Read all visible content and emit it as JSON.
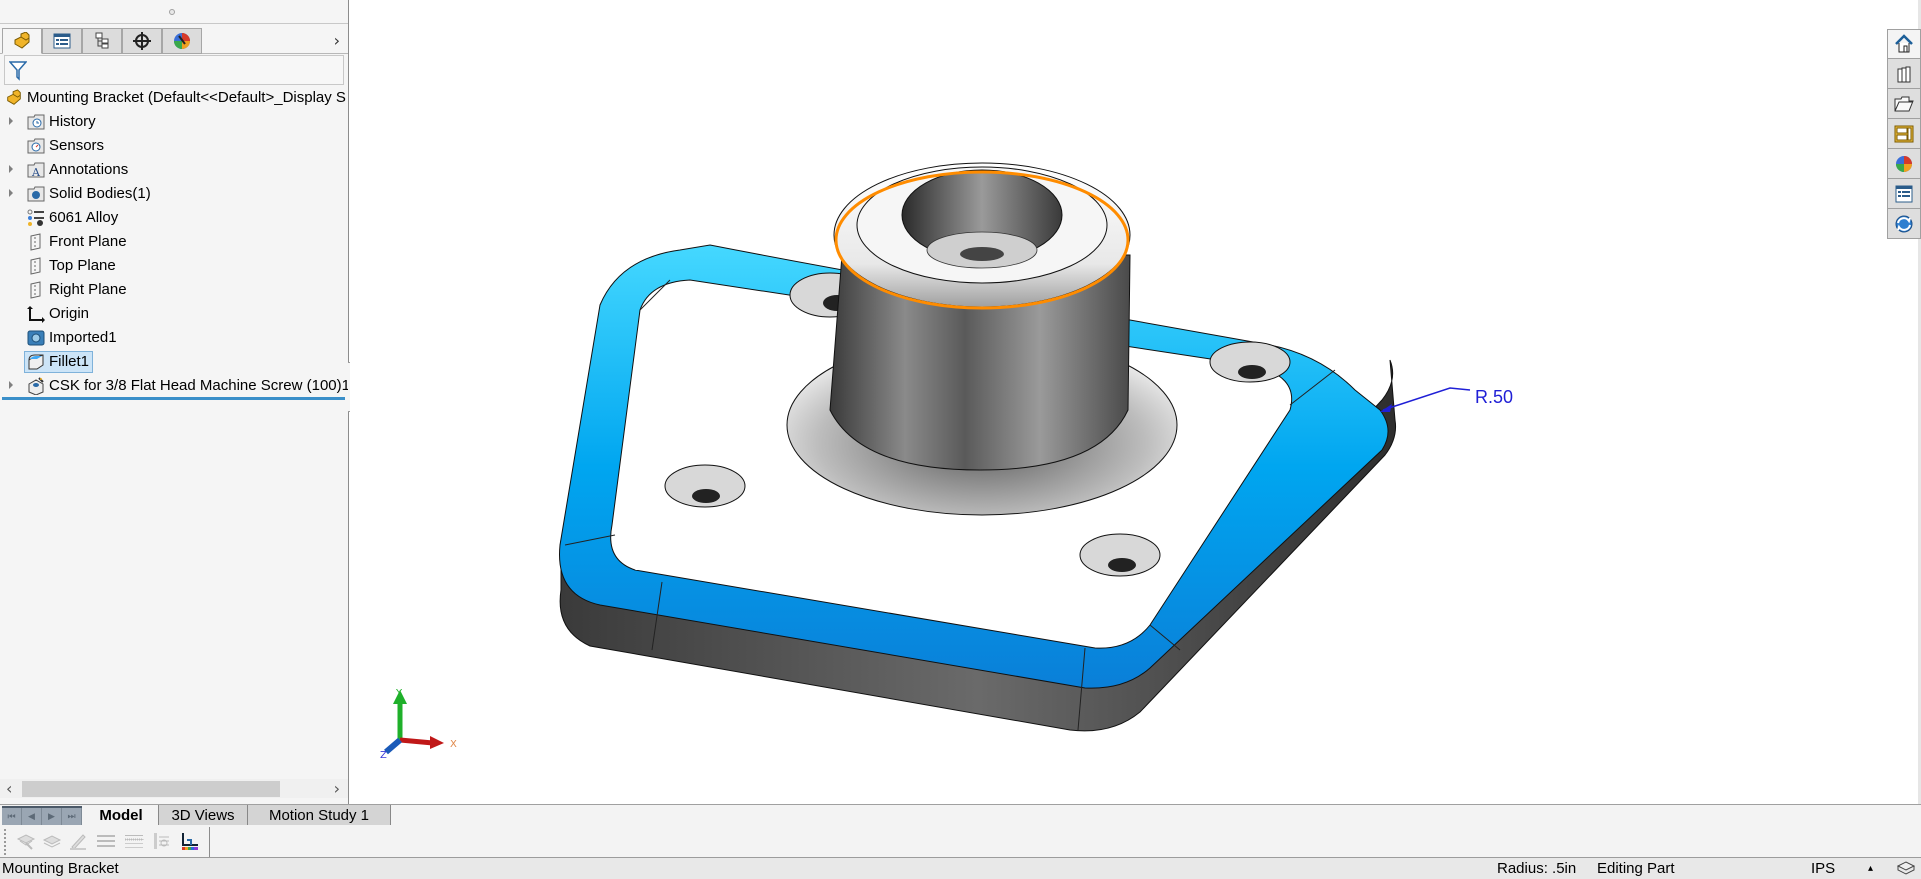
{
  "feature_manager": {
    "tabs": [
      {
        "name": "featuremanager-tab",
        "icon": "part-icon",
        "active": true
      },
      {
        "name": "propertymanager-tab",
        "icon": "property-list-icon",
        "active": false
      },
      {
        "name": "configurationmanager-tab",
        "icon": "configuration-icon",
        "active": false
      },
      {
        "name": "dimxpert-tab",
        "icon": "crosshair-icon",
        "active": false
      },
      {
        "name": "displaymanager-tab",
        "icon": "appearance-sphere-icon",
        "active": false
      }
    ],
    "more_tabs": "›",
    "tree": {
      "root": "Mounting Bracket  (Default<<Default>_Display S",
      "items": [
        {
          "label": "History",
          "icon": "history-folder-icon",
          "expandable": true
        },
        {
          "label": "Sensors",
          "icon": "sensors-folder-icon",
          "expandable": false
        },
        {
          "label": "Annotations",
          "icon": "annotations-folder-icon",
          "expandable": true
        },
        {
          "label": "Solid Bodies(1)",
          "icon": "solid-bodies-folder-icon",
          "expandable": true
        },
        {
          "label": "6061 Alloy",
          "icon": "material-icon",
          "expandable": false
        },
        {
          "label": "Front Plane",
          "icon": "plane-icon",
          "expandable": false
        },
        {
          "label": "Top Plane",
          "icon": "plane-icon",
          "expandable": false
        },
        {
          "label": "Right Plane",
          "icon": "plane-icon",
          "expandable": false
        },
        {
          "label": "Origin",
          "icon": "origin-icon",
          "expandable": false
        },
        {
          "label": "Imported1",
          "icon": "imported-body-icon",
          "expandable": false
        },
        {
          "label": "Fillet1",
          "icon": "fillet-icon",
          "expandable": false,
          "selected": true
        },
        {
          "label": "CSK for 3/8 Flat Head Machine Screw (100)1",
          "icon": "hole-wizard-icon",
          "expandable": true
        }
      ]
    },
    "scroll_left": "‹",
    "scroll_right": "›"
  },
  "viewport": {
    "dimension_label": "R.50",
    "triad": {
      "x": "X",
      "y": "Y",
      "z": "Z"
    },
    "colors": {
      "fillet_highlight": "#00aaff",
      "selected_edge": "#ff8c00",
      "dimension": "#1f1fd6"
    }
  },
  "task_pane": [
    {
      "name": "solidworks-resources-button",
      "icon": "home-icon"
    },
    {
      "name": "design-library-button",
      "icon": "design-library-icon"
    },
    {
      "name": "file-explorer-button",
      "icon": "folder-icon"
    },
    {
      "name": "view-palette-button",
      "icon": "view-palette-icon"
    },
    {
      "name": "appearances-button",
      "icon": "appearances-icon"
    },
    {
      "name": "custom-properties-button",
      "icon": "custom-properties-icon"
    },
    {
      "name": "solidworks-forum-button",
      "icon": "forum-icon"
    }
  ],
  "bottom_tabs": {
    "nav": [
      "⏮",
      "◀",
      "▶",
      "⏭"
    ],
    "tabs": [
      {
        "label": "Model",
        "active": true
      },
      {
        "label": "3D Views",
        "active": false
      },
      {
        "label": "Motion Study 1",
        "active": false
      }
    ]
  },
  "status_bar": {
    "document": "Mounting Bracket",
    "measurement": "Radius: .5in",
    "mode": "Editing Part",
    "units": "IPS",
    "units_arrow": "▴"
  }
}
